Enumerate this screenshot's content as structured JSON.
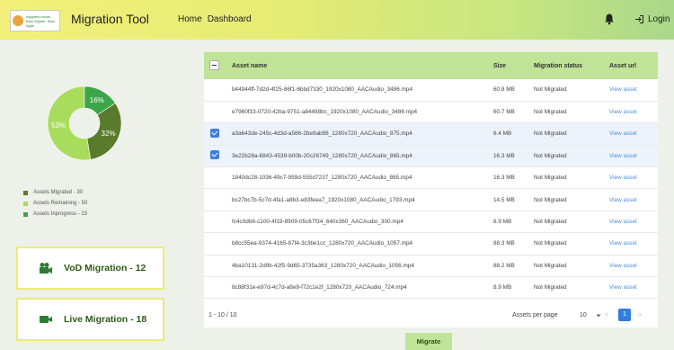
{
  "header": {
    "logo_line1": "happiest minds",
    "logo_line2": "Born Digital . Born Agile",
    "app_title": "Migration Tool",
    "nav": [
      "Home",
      "Dashboard"
    ],
    "login_label": "Login"
  },
  "chart_data": {
    "type": "pie",
    "categories": [
      "Assets Migrated",
      "Assets Remaining",
      "Assets Inprogress"
    ],
    "values": [
      30,
      50,
      15
    ],
    "slice_labels": [
      "32%",
      "53%",
      "16%"
    ],
    "colors": [
      "#5a7a2c",
      "#a8dc5c",
      "#3aa649"
    ],
    "legend_labels": [
      "Assets Migrated - 30",
      "Assets Remaining - 50",
      "Assets Inprogress - 15"
    ],
    "legend_placement": "bottom-left"
  },
  "migration_cards": [
    {
      "label": "VoD Migration - 12",
      "icon": "film-icon"
    },
    {
      "label": "Live Migration - 18",
      "icon": "video-camera-icon"
    }
  ],
  "table": {
    "columns": [
      "Asset name",
      "Size",
      "Migration status",
      "Asset url"
    ],
    "rows": [
      {
        "checked": false,
        "name": "b44944ff-7d2d-4f25-86f1-6bbd7330_1920x1080_AACAudio_3486.mp4",
        "size": "60.8 MB",
        "status": "Not Migrated",
        "url": "View asset"
      },
      {
        "checked": false,
        "name": "e7960f33-0720-42ba-9751-a84488bc_1920x1080_AACAudio_3486.mp4",
        "size": "60.7 MB",
        "status": "Not Migrated",
        "url": "View asset"
      },
      {
        "checked": true,
        "name": "a3a643de-245c-4d3d-a566-2be9ab98_1280x720_AACAudio_875.mp4",
        "size": "6.4 MB",
        "status": "Not Migrated",
        "url": "View asset"
      },
      {
        "checked": true,
        "name": "3e22b28a-6843-4539-b00b-20c26749_1280x720_AACAudio_865.mp4",
        "size": "16.3 MB",
        "status": "Not Migrated",
        "url": "View asset"
      },
      {
        "checked": false,
        "name": "1840dc28-1036-49c7-959d-555d7237_1280x720_AACAudio_865.mp4",
        "size": "16.3 MB",
        "status": "Not Migrated",
        "url": "View asset"
      },
      {
        "checked": false,
        "name": "bc27bc7b-5c7d-4fa1-a8b3-e83feea7_1920x1080_AACAudio_1793.mp4",
        "size": "14.5 MB",
        "status": "Not Migrated",
        "url": "View asset"
      },
      {
        "checked": false,
        "name": "fc4c0db6-c100-4f19-8909-05c67f34_640x360_AACAudio_300.mp4",
        "size": "6.9 MB",
        "status": "Not Migrated",
        "url": "View asset"
      },
      {
        "checked": false,
        "name": "b8cc55ea-9374-4165-87f4-3c3be1cc_1280x720_AACAudio_1057.mp4",
        "size": "88.3 MB",
        "status": "Not Migrated",
        "url": "View asset"
      },
      {
        "checked": false,
        "name": "4ba10131-2d9b-42f5-9d65-3735a363_1280x720_AACAudio_1056.mp4",
        "size": "88.2 MB",
        "status": "Not Migrated",
        "url": "View asset"
      },
      {
        "checked": false,
        "name": "8c88f31e-e97d-4c7d-a8e9-f72c1e2f_1280x720_AACAudio_724.mp4",
        "size": "8.9 MB",
        "status": "Not Migrated",
        "url": "View asset"
      }
    ]
  },
  "pagination": {
    "range": "1 - 10 / 10",
    "per_page_label": "Assets per page",
    "per_page_value": "10",
    "prev": "<",
    "current_page": "1",
    "next": ">"
  },
  "migrate_label": "Migrate"
}
